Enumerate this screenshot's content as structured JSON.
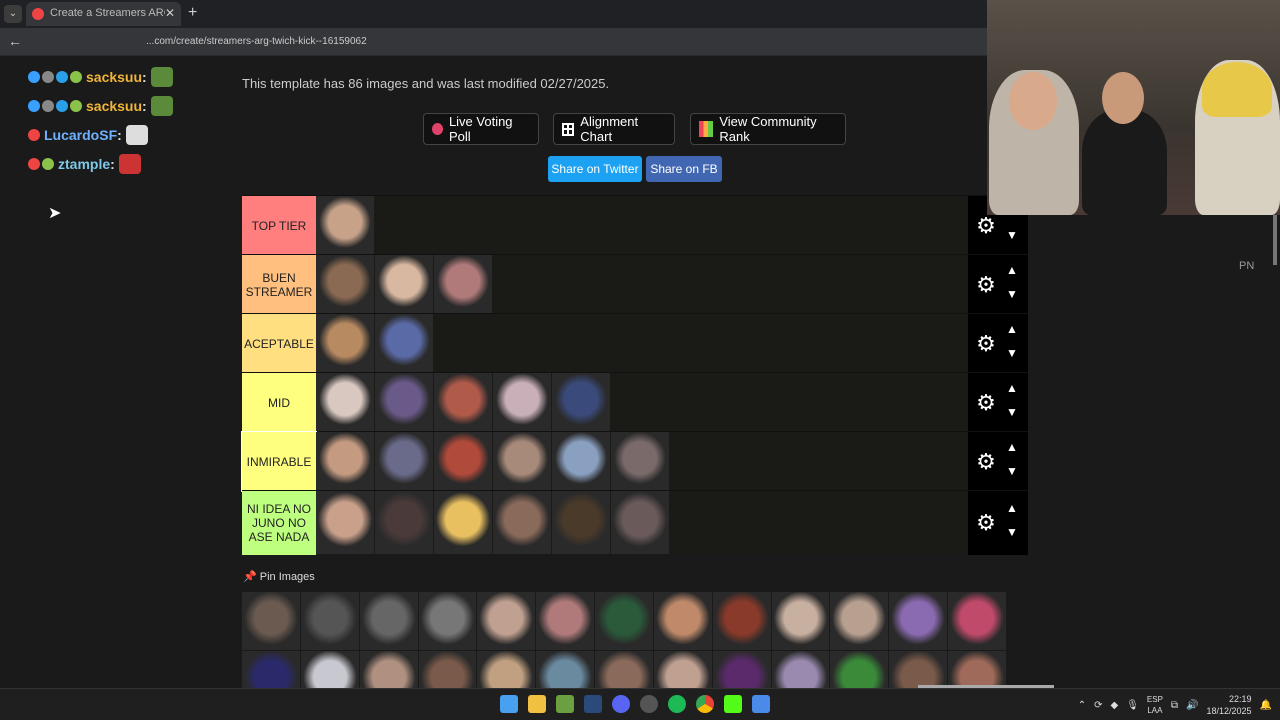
{
  "browser": {
    "tab_title": "Create a Streamers ARG Twich...",
    "url": "...com/create/streamers-arg-twich-kick--16159062"
  },
  "chat": [
    {
      "user": "sacksuu",
      "color": "#f0b53a",
      "badges": [
        "#3aa0ff",
        "#888",
        "#29a0e8",
        "#8bc34a"
      ],
      "emote": "#5a8a3a"
    },
    {
      "user": "sacksuu",
      "color": "#f0b53a",
      "badges": [
        "#3aa0ff",
        "#888",
        "#29a0e8",
        "#8bc34a"
      ],
      "emote": "#5a8a3a"
    },
    {
      "user": "LucardoSF",
      "color": "#6fb0ff",
      "badges": [
        "#e44"
      ],
      "emote": "#ddd"
    },
    {
      "user": "ztample",
      "color": "#7ec8e8",
      "badges": [
        "#e44",
        "#8bc34a"
      ],
      "emote": "#c33"
    }
  ],
  "page": {
    "info": "This template has 86 images and was last modified 02/27/2025.",
    "buttons": {
      "live_poll": "Live Voting Poll",
      "alignment": "Alignment Chart",
      "community": "View Community Rank"
    },
    "share_twitter": "Share on Twitter",
    "share_fb": "Share on FB",
    "pin_images": "Pin Images",
    "side_label": "PN"
  },
  "tiers": [
    {
      "label": "TOP TIER",
      "color": "#ff7f7f",
      "items": [
        "#c7a289"
      ]
    },
    {
      "label": "BUEN STREAMER",
      "color": "#ffbf7f",
      "items": [
        "#8a6a52",
        "#d9b8a1",
        "#b07a7a"
      ]
    },
    {
      "label": "ACEPTABLE",
      "color": "#ffdf7f",
      "items": [
        "#b88a62",
        "#5a6aa6"
      ]
    },
    {
      "label": "MID",
      "color": "#ffff7f",
      "items": [
        "#d8c8c0",
        "#6a5a8a",
        "#b05a4a",
        "#c9b0b8",
        "#3a4a7a"
      ]
    },
    {
      "label": "INMIRABLE",
      "color": "#ffff7f",
      "items": [
        "#c49a80",
        "#6a6a8a",
        "#b04a3a",
        "#a88a7a",
        "#8aa0c0",
        "#7a6a6a"
      ]
    },
    {
      "label": "NI IDEA NO JUNO NO ASE NADA",
      "color": "#bfff7f",
      "items": [
        "#c9a08a",
        "#4a3a3a",
        "#e8c060",
        "#8a6a5a",
        "#4a3a2a",
        "#6a5a5a"
      ]
    }
  ],
  "pool": [
    [
      "#6a5a50",
      "#555",
      "#666",
      "#777",
      "#c0a090",
      "#b07a7a",
      "#2a5a3a",
      "#c08a6a",
      "#8a3a2a",
      "#c8b0a0",
      "#b8a090",
      "#8a6ab0",
      "#c04a6a"
    ],
    [
      "#2a2a6a",
      "#c8c8d0",
      "#b09080",
      "#7a5a4a",
      "#c0a080",
      "#6a8aa0",
      "#8a6a5a",
      "#c0a090",
      "#5a2a6a",
      "#9a8ab0",
      "#3a8a3a",
      "#7a5a4a",
      "#a06a5a"
    ]
  ],
  "taskbar": {
    "lang_top": "ESP",
    "lang_bottom": "LAA",
    "time": "22:19",
    "date": "18/12/2025"
  }
}
